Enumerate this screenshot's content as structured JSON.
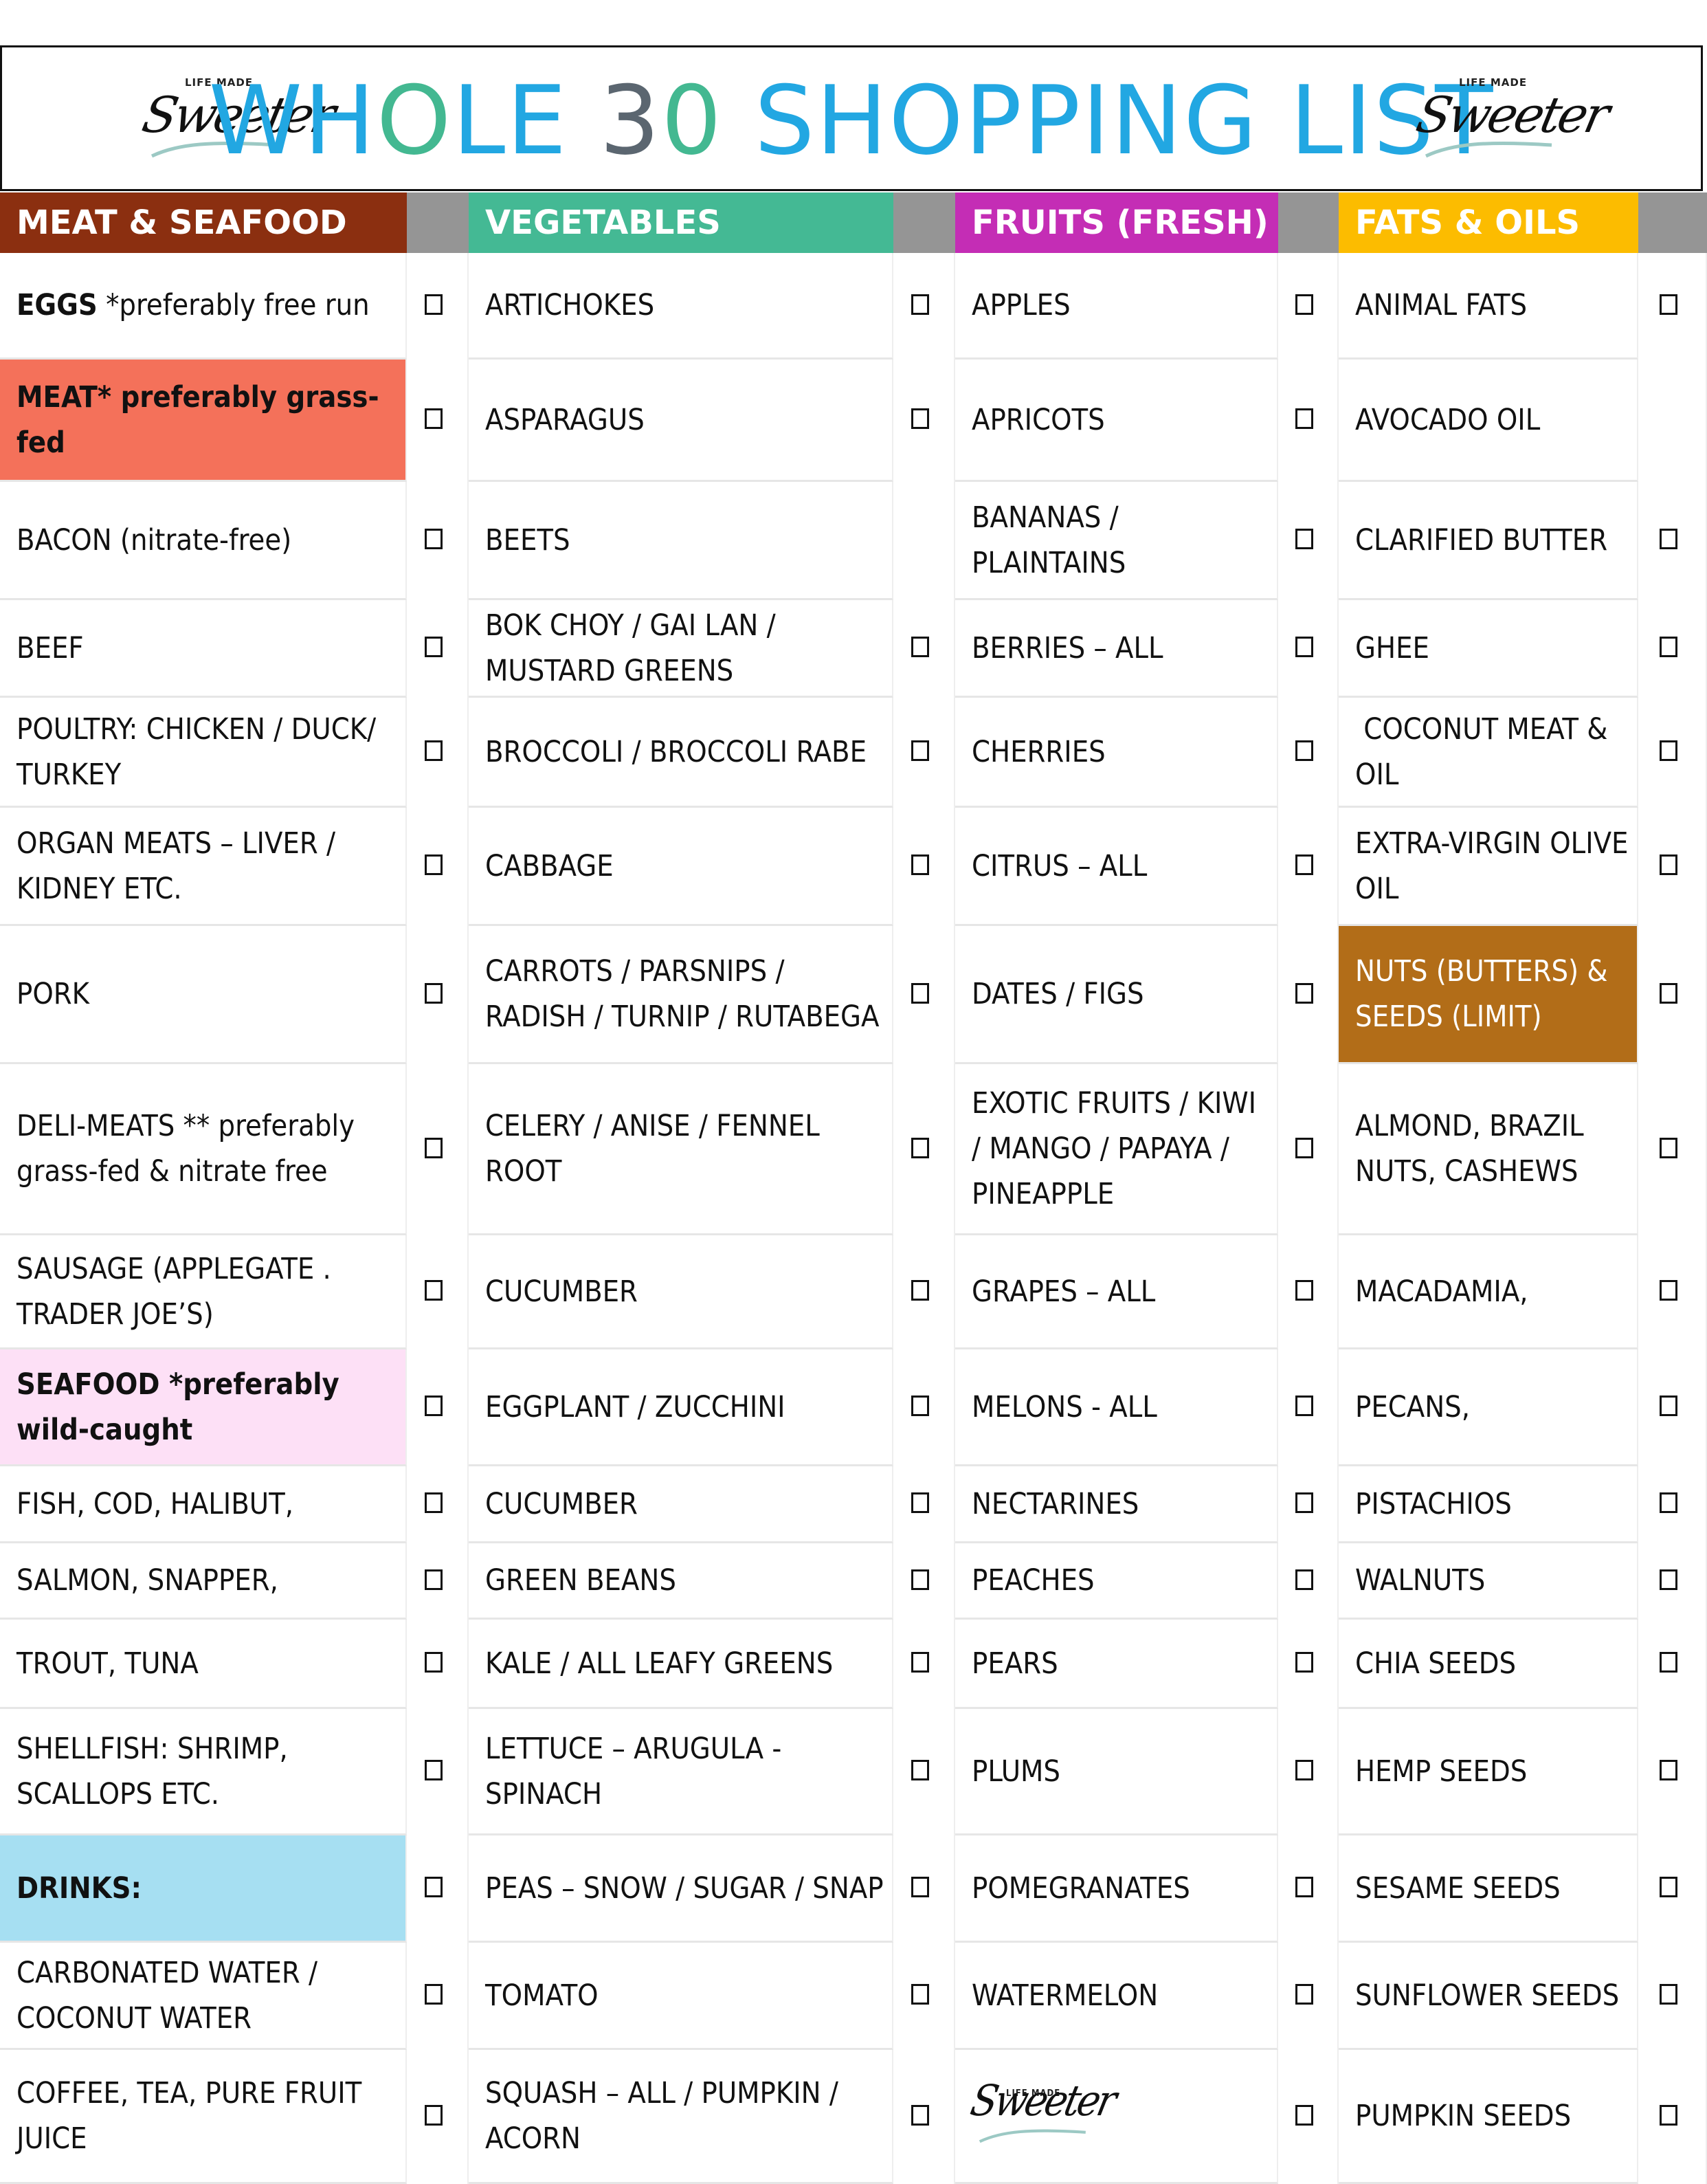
{
  "title": {
    "part1": "WH",
    "o1": "O",
    "part2": "LE ",
    "three": "3",
    "zero": "0",
    "part3": " SHOPPING LIST",
    "full": "WHOLE 30 SHOPPING LIST",
    "colors": {
      "blue": "#22a7e2",
      "green": "#43b891",
      "gray": "#5b6670"
    }
  },
  "logo": {
    "small": "LIFE MADE",
    "script": "Sweeter"
  },
  "columns": [
    {
      "header": "MEAT & SEAFOOD",
      "color": "#8b2f10"
    },
    {
      "header": "VEGETABLES",
      "color": "#44b994"
    },
    {
      "header": "FRUITS (FRESH)",
      "color": "#c42db5"
    },
    {
      "header": "FATS & OILS",
      "color": "#fcbc00"
    }
  ],
  "highlight_colors": {
    "meat": "#f4715a",
    "seafood": "#fde0f6",
    "drinks": "#a6dff2",
    "nuts": "#b26d18"
  },
  "meat": [
    {
      "bold": "EGGS",
      "text": " *preferably free run",
      "checkbox": true
    },
    {
      "bold": "MEAT* preferably grass-fed",
      "text": "",
      "checkbox": true,
      "highlight": "meat"
    },
    {
      "text": "BACON (nitrate-free)",
      "checkbox": true
    },
    {
      "text": "BEEF",
      "checkbox": true
    },
    {
      "text": "POULTRY: CHICKEN / DUCK/ TURKEY",
      "checkbox": true
    },
    {
      "text": "ORGAN MEATS – LIVER / KIDNEY ETC.",
      "checkbox": true
    },
    {
      "text": "PORK",
      "checkbox": true
    },
    {
      "text": "DELI-MEATS ** preferably grass-fed & nitrate free",
      "checkbox": true
    },
    {
      "text": "SAUSAGE (APPLEGATE . TRADER JOE’S)",
      "checkbox": true
    },
    {
      "bold": "SEAFOOD *preferably wild-caught",
      "text": "",
      "checkbox": true,
      "highlight": "seafood"
    },
    {
      "text": "FISH, COD, HALIBUT,",
      "checkbox": true
    },
    {
      "text": "SALMON, SNAPPER,",
      "checkbox": true
    },
    {
      "text": "TROUT, TUNA",
      "checkbox": true
    },
    {
      "text": "SHELLFISH: SHRIMP, SCALLOPS ETC.",
      "checkbox": true
    },
    {
      "bold": "DRINKS:",
      "text": "",
      "checkbox": true,
      "highlight": "drinks"
    },
    {
      "text": "CARBONATED WATER / COCONUT WATER",
      "checkbox": true
    },
    {
      "text": "COFFEE, TEA, PURE FRUIT JUICE",
      "checkbox": true
    }
  ],
  "vegetables": [
    {
      "text": "ARTICHOKES",
      "checkbox": true
    },
    {
      "text": "ASPARAGUS",
      "checkbox": true
    },
    {
      "text": "BEETS",
      "checkbox": false
    },
    {
      "text": "BOK CHOY / GAI LAN / MUSTARD GREENS",
      "checkbox": true
    },
    {
      "text": "BROCCOLI / BROCCOLI RABE",
      "checkbox": true
    },
    {
      "text": "CABBAGE",
      "checkbox": true
    },
    {
      "text": "CARROTS / PARSNIPS / RADISH / TURNIP / RUTABEGA",
      "checkbox": true
    },
    {
      "text": "CELERY / ANISE / FENNEL ROOT",
      "checkbox": true
    },
    {
      "text": "CUCUMBER",
      "checkbox": true
    },
    {
      "text": "EGGPLANT / ZUCCHINI",
      "checkbox": true
    },
    {
      "text": "CUCUMBER",
      "checkbox": true
    },
    {
      "text": "GREEN BEANS",
      "checkbox": true
    },
    {
      "text": "KALE / ALL LEAFY GREENS",
      "checkbox": true
    },
    {
      "text": "LETTUCE – ARUGULA - SPINACH",
      "checkbox": true
    },
    {
      "text": "PEAS – SNOW / SUGAR / SNAP",
      "checkbox": true
    },
    {
      "text": "TOMATO",
      "checkbox": true
    },
    {
      "text": "SQUASH – ALL / PUMPKIN / ACORN",
      "checkbox": true
    }
  ],
  "fruits": [
    {
      "text": "APPLES",
      "checkbox": true
    },
    {
      "text": "APRICOTS",
      "checkbox": true
    },
    {
      "text": "BANANAS / PLAINTAINS",
      "checkbox": true
    },
    {
      "text": "BERRIES – ALL",
      "checkbox": true
    },
    {
      "text": "CHERRIES",
      "checkbox": true
    },
    {
      "text": "CITRUS – ALL",
      "checkbox": true
    },
    {
      "text": "DATES / FIGS",
      "checkbox": true
    },
    {
      "text": "EXOTIC FRUITS / KIWI / MANGO / PAPAYA / PINEAPPLE",
      "checkbox": true
    },
    {
      "text": "GRAPES – ALL",
      "checkbox": true
    },
    {
      "text": "MELONS - ALL",
      "checkbox": true
    },
    {
      "text": "NECTARINES",
      "checkbox": true
    },
    {
      "text": "PEACHES",
      "checkbox": true
    },
    {
      "text": "PEARS",
      "checkbox": true
    },
    {
      "text": "PLUMS",
      "checkbox": true
    },
    {
      "text": "POMEGRANATES",
      "checkbox": true
    },
    {
      "text": "WATERMELON",
      "checkbox": true
    },
    {
      "text": "",
      "logo": true,
      "checkbox": true
    }
  ],
  "fats": [
    {
      "text": "ANIMAL FATS",
      "checkbox": true
    },
    {
      "text": "AVOCADO OIL",
      "checkbox": false
    },
    {
      "text": "CLARIFIED BUTTER",
      "checkbox": true
    },
    {
      "text": "GHEE",
      "checkbox": true
    },
    {
      "text": " COCONUT MEAT & OIL",
      "checkbox": true
    },
    {
      "text": "EXTRA-VIRGIN OLIVE OIL",
      "checkbox": true
    },
    {
      "text": "NUTS (BUTTERS) & SEEDS (LIMIT)",
      "checkbox": true,
      "highlight": "nuts"
    },
    {
      "text": "ALMOND, BRAZIL NUTS, CASHEWS",
      "checkbox": true
    },
    {
      "text": "MACADAMIA,",
      "checkbox": true
    },
    {
      "text": "PECANS,",
      "checkbox": true
    },
    {
      "text": "PISTACHIOS",
      "checkbox": true
    },
    {
      "text": "WALNUTS",
      "checkbox": true
    },
    {
      "text": "CHIA SEEDS",
      "checkbox": true
    },
    {
      "text": "HEMP SEEDS",
      "checkbox": true
    },
    {
      "text": "SESAME SEEDS",
      "checkbox": true
    },
    {
      "text": "SUNFLOWER SEEDS",
      "checkbox": true
    },
    {
      "text": "PUMPKIN SEEDS",
      "checkbox": true
    }
  ]
}
